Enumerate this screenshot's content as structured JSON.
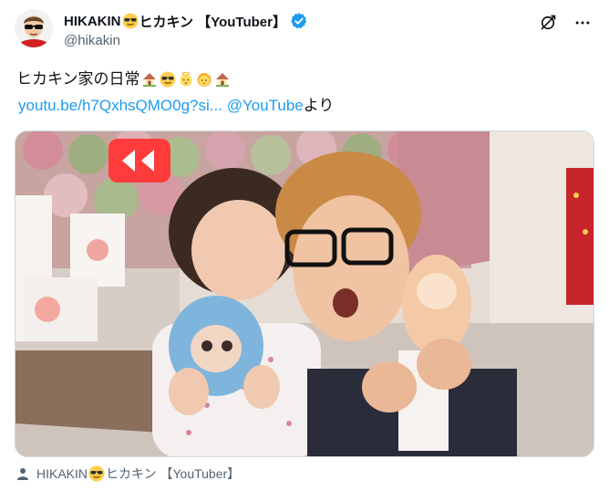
{
  "author": {
    "name_prefix": "HIKAKIN",
    "name_suffix": "ヒカキン 【YouTuber】",
    "handle": "@hikakin",
    "name_emoji": "smiling-face-with-sunglasses-icon",
    "verified_badge": "verified-badge-icon",
    "verified_color": "#1d9bf0"
  },
  "header_actions": [
    {
      "name": "grok-icon"
    },
    {
      "name": "more-options-icon",
      "label": "···"
    }
  ],
  "post": {
    "text": "ヒカキン家の日常",
    "text_emojis": [
      "house-with-garden-icon",
      "smiling-face-with-sunglasses-icon",
      "baby-angel-icon",
      "baby-icon",
      "house-with-garden-icon"
    ],
    "link_text": "youtu.be/h7QxhsQMO0g?si...",
    "mention_text": "@YouTube",
    "trailing_text": "より"
  },
  "media": {
    "play_button": "play-rewind-icon",
    "description_colors": {
      "accent": "#ff3b3b",
      "background": "#d8c3b4"
    }
  },
  "footer": {
    "icon": "person-icon",
    "name_prefix": "HIKAKIN",
    "name_suffix": "ヒカキン 【YouTuber】"
  },
  "colors": {
    "link": "#1d9bf0",
    "secondary_text": "#536471",
    "primary_text": "#0f1419"
  }
}
